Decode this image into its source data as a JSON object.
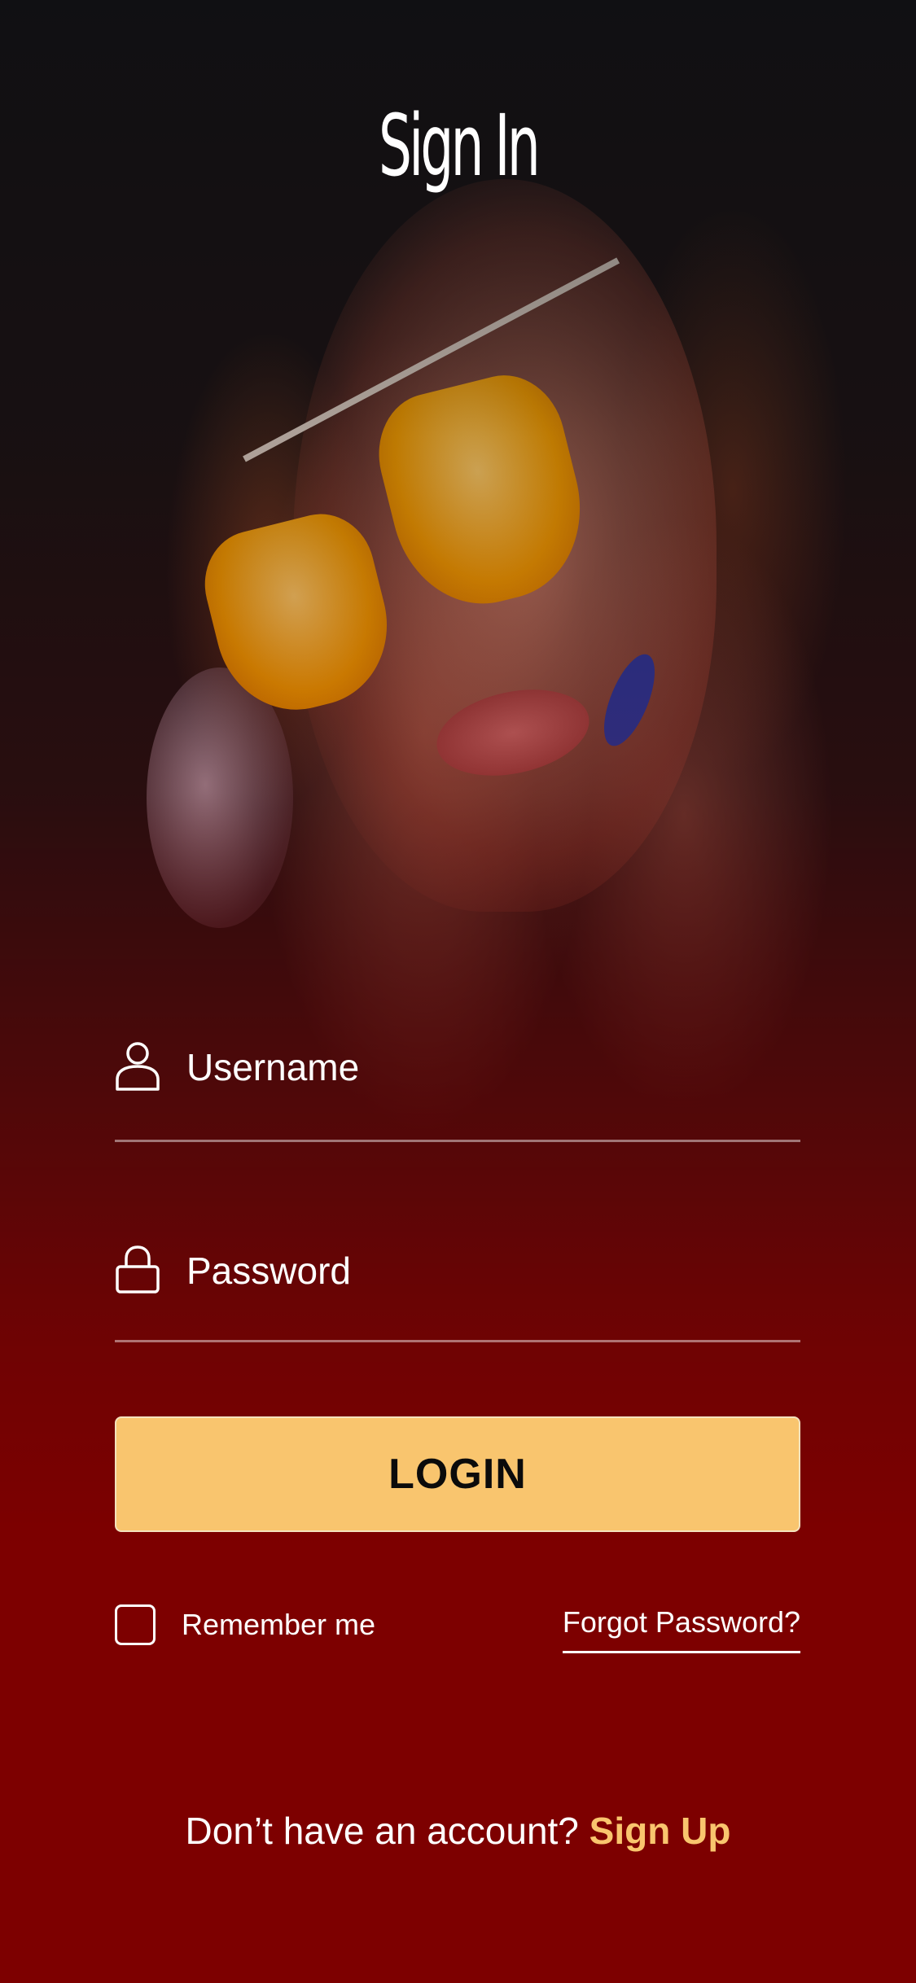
{
  "screen": {
    "title": "Sign In"
  },
  "form": {
    "username_placeholder": "Username",
    "password_placeholder": "Password",
    "login_label": "LOGIN",
    "remember_label": "Remember me",
    "forgot_label": "Forgot Password?"
  },
  "footer": {
    "prompt": "Don’t have an account?",
    "signup_label": "Sign Up"
  },
  "colors": {
    "accent": "#F9C56E",
    "background_bottom": "#7D0000",
    "text": "#FFFFFF"
  },
  "icons": {
    "username": "user-icon",
    "password": "lock-icon"
  }
}
